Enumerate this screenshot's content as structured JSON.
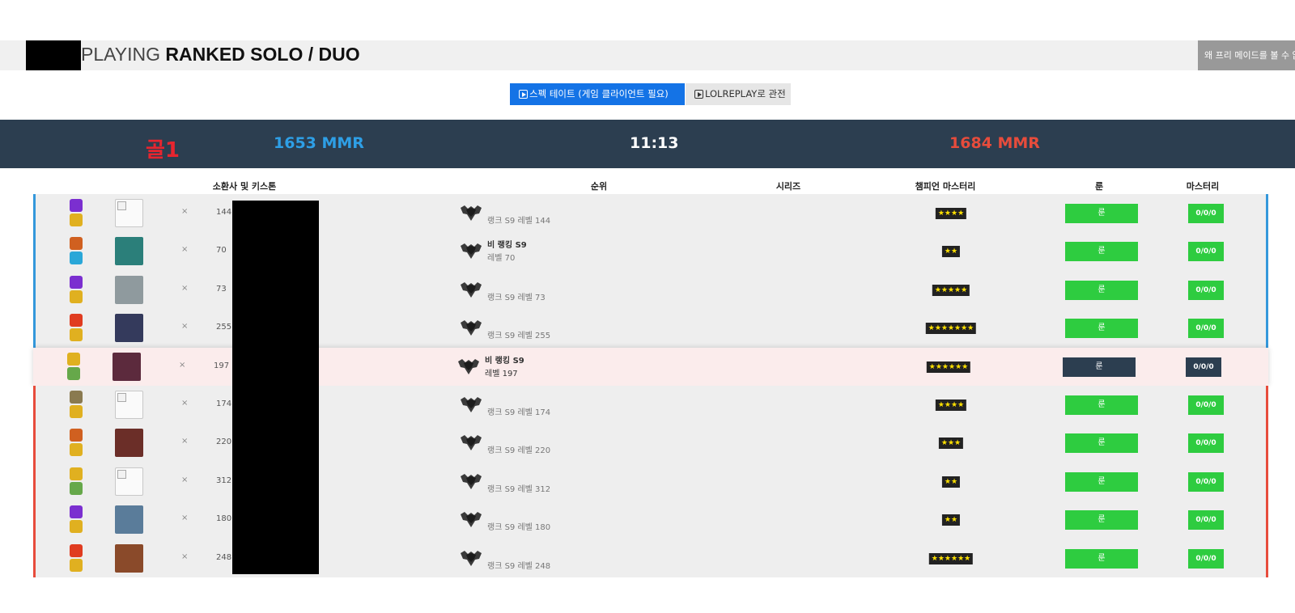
{
  "header": {
    "title_light": "PLAYING",
    "title_bold": "RANKED SOLO / DUO",
    "side_note": "왜 프리 메이드를 볼 수 없"
  },
  "actions": {
    "spectate_label": "스펙 테이트 (게임 클라이언트 필요)",
    "replay_label": "LOLREPLAY로 관전"
  },
  "scoreboard": {
    "team_label": "골1",
    "blue_mmr": "1653 MMR",
    "clock": "11:13",
    "red_mmr": "1684 MMR"
  },
  "columns": {
    "summoner": "소환사 및 키스톤",
    "rank": "순위",
    "series": "시리즈",
    "champion_mastery": "챔피언 마스터리",
    "runes": "룬",
    "masteries": "마스터리"
  },
  "colors": {
    "blue_team": "#3498db",
    "red_team": "#e74c3c",
    "rune_green": "#2ecc40",
    "dark_navy": "#2c3e50"
  },
  "rows": [
    {
      "team": "blue",
      "spells": [
        "#7b2fd0",
        "#e0b020"
      ],
      "champ": "empty",
      "x": "×",
      "level": "144",
      "rank_line1": "랭크 S9 레벨 144",
      "rank_line2": "",
      "stars": "★★★★",
      "stars_n": 4,
      "rune": "룬",
      "mastery": "0/0/0",
      "me": false
    },
    {
      "team": "blue",
      "spells": [
        "#d06020",
        "#2aa7d8"
      ],
      "champ": "#2b7f7a",
      "x": "×",
      "level": "70",
      "rank_line1": "비 랭킹 S9",
      "rank_line2": "레벨 70",
      "stars": "★★",
      "stars_n": 2,
      "rune": "룬",
      "mastery": "0/0/0",
      "me": false
    },
    {
      "team": "blue",
      "spells": [
        "#7b2fd0",
        "#e0b020"
      ],
      "champ": "#8f9a9e",
      "x": "×",
      "level": "73",
      "rank_line1": "랭크 S9 레벨 73",
      "rank_line2": "",
      "stars": "★★★★★",
      "stars_n": 5,
      "rune": "룬",
      "mastery": "0/0/0",
      "me": false
    },
    {
      "team": "blue",
      "spells": [
        "#e03c20",
        "#e0b020"
      ],
      "champ": "#343a5c",
      "x": "×",
      "level": "255",
      "rank_line1": "랭크 S9 레벨 255",
      "rank_line2": "",
      "stars": "★★★★★★★",
      "stars_n": 7,
      "rune": "룬",
      "mastery": "0/0/0",
      "me": false
    },
    {
      "team": "me",
      "spells": [
        "#e0b020",
        "#66a84a"
      ],
      "champ": "#5c2a3d",
      "x": "×",
      "level": "197",
      "rank_line1": "비 랭킹 S9",
      "rank_line2": "레벨 197",
      "stars": "★★★★★★",
      "stars_n": 6,
      "rune": "룬",
      "mastery": "0/0/0",
      "me": true
    },
    {
      "team": "red",
      "spells": [
        "#8a7a50",
        "#e0b020"
      ],
      "champ": "empty",
      "x": "×",
      "level": "174",
      "rank_line1": "랭크 S9 레벨 174",
      "rank_line2": "",
      "stars": "★★★★",
      "stars_n": 4,
      "rune": "룬",
      "mastery": "0/0/0",
      "me": false
    },
    {
      "team": "red",
      "spells": [
        "#d06020",
        "#e0b020"
      ],
      "champ": "#6b2e28",
      "x": "×",
      "level": "220",
      "rank_line1": "랭크 S9 레벨 220",
      "rank_line2": "",
      "stars": "★★★",
      "stars_n": 3,
      "rune": "룬",
      "mastery": "0/0/0",
      "me": false
    },
    {
      "team": "red",
      "spells": [
        "#e0b020",
        "#66a84a"
      ],
      "champ": "empty",
      "x": "×",
      "level": "312",
      "rank_line1": "랭크 S9 레벨 312",
      "rank_line2": "",
      "stars": "★★",
      "stars_n": 2,
      "rune": "룬",
      "mastery": "0/0/0",
      "me": false
    },
    {
      "team": "red",
      "spells": [
        "#7b2fd0",
        "#e0b020"
      ],
      "champ": "#5a7c9a",
      "x": "×",
      "level": "180",
      "rank_line1": "랭크 S9 레벨 180",
      "rank_line2": "",
      "stars": "★★",
      "stars_n": 2,
      "rune": "룬",
      "mastery": "0/0/0",
      "me": false
    },
    {
      "team": "red",
      "spells": [
        "#e03c20",
        "#e0b020"
      ],
      "champ": "#8a4a2a",
      "x": "×",
      "level": "248",
      "rank_line1": "랭크 S9 레벨 248",
      "rank_line2": "",
      "stars": "★★★★★★",
      "stars_n": 6,
      "rune": "룬",
      "mastery": "0/0/0",
      "me": false
    }
  ]
}
